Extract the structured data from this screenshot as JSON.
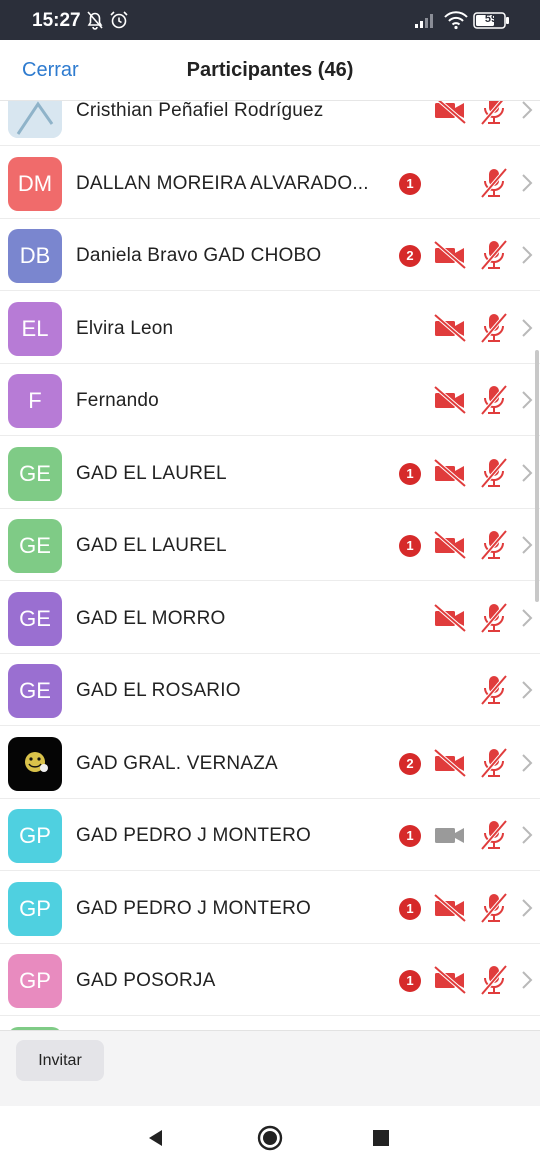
{
  "status_bar": {
    "time": "15:27",
    "battery": "59",
    "icons": [
      "mute-bell-icon",
      "alarm-icon",
      "signal-icon",
      "wifi-icon",
      "battery-icon"
    ]
  },
  "header": {
    "close_label": "Cerrar",
    "title": "Participantes (46)"
  },
  "participants": [
    {
      "name": "Cristhian Peñafiel Rodríguez",
      "initials": "",
      "avatar_color": "#d8e6f0",
      "badge": "",
      "video": "off",
      "mic": "muted"
    },
    {
      "name": "DALLAN MOREIRA ALVARADO...",
      "initials": "DM",
      "avatar_color": "#f06b6b",
      "badge": "1",
      "video": "none",
      "mic": "muted"
    },
    {
      "name": "Daniela Bravo GAD CHOBO",
      "initials": "DB",
      "avatar_color": "#7a86cf",
      "badge": "2",
      "video": "off",
      "mic": "muted"
    },
    {
      "name": "Elvira Leon",
      "initials": "EL",
      "avatar_color": "#b77bd6",
      "badge": "",
      "video": "off",
      "mic": "muted"
    },
    {
      "name": "Fernando",
      "initials": "F",
      "avatar_color": "#b77bd6",
      "badge": "",
      "video": "off",
      "mic": "muted"
    },
    {
      "name": "GAD EL LAUREL",
      "initials": "GE",
      "avatar_color": "#7fcb86",
      "badge": "1",
      "video": "off",
      "mic": "muted"
    },
    {
      "name": "GAD EL LAUREL",
      "initials": "GE",
      "avatar_color": "#7fcb86",
      "badge": "1",
      "video": "off",
      "mic": "muted"
    },
    {
      "name": "GAD EL MORRO",
      "initials": "GE",
      "avatar_color": "#9a6fd1",
      "badge": "",
      "video": "off",
      "mic": "muted"
    },
    {
      "name": "GAD EL ROSARIO",
      "initials": "GE",
      "avatar_color": "#9a6fd1",
      "badge": "",
      "video": "none",
      "mic": "muted"
    },
    {
      "name": "GAD GRAL. VERNAZA",
      "initials": "",
      "avatar_color": "#050505",
      "badge": "2",
      "video": "off",
      "mic": "muted"
    },
    {
      "name": "GAD PEDRO J MONTERO",
      "initials": "GP",
      "avatar_color": "#4fd0e0",
      "badge": "1",
      "video": "on",
      "mic": "muted"
    },
    {
      "name": "GAD PEDRO J MONTERO",
      "initials": "GP",
      "avatar_color": "#4fd0e0",
      "badge": "1",
      "video": "off",
      "mic": "muted"
    },
    {
      "name": "GAD POSORJA",
      "initials": "GP",
      "avatar_color": "#e88bbf",
      "badge": "1",
      "video": "off",
      "mic": "muted"
    },
    {
      "name": "",
      "initials": "",
      "avatar_color": "#7fcb86",
      "badge": "",
      "video": "off",
      "mic": "muted"
    }
  ],
  "footer": {
    "invite_label": "Invitar"
  },
  "nav_bar": {
    "icons": [
      "back-icon",
      "home-icon",
      "recents-icon"
    ]
  },
  "colors": {
    "status_bar_bg": "#2b2f3a",
    "accent_blue": "#2e7bcf",
    "muted_red": "#e03c3c",
    "badge_red": "#d62a2a"
  }
}
